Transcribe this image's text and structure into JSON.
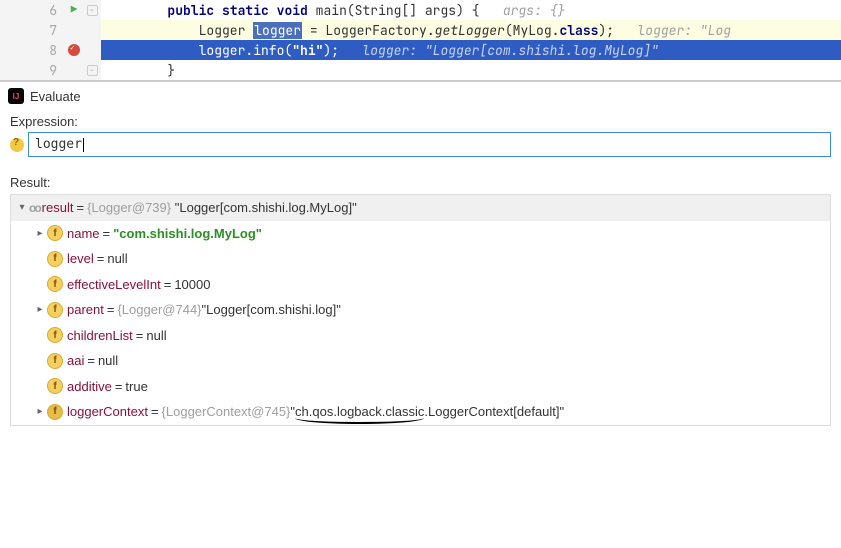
{
  "editor": {
    "lines": {
      "l6": {
        "no": "6",
        "indent": "        ",
        "k1": "public",
        "k2": "static",
        "k3": "void",
        "method": "main",
        "args": "(String[] args) {",
        "hint": "args: {}"
      },
      "l7": {
        "no": "7",
        "indent": "            ",
        "t1": "Logger ",
        "sel": "logger",
        "t2": " = LoggerFactory.",
        "call": "getLogger",
        "t3": "(MyLog.",
        "cls": "class",
        "t4": ");",
        "hint": "logger: \"Log"
      },
      "l8": {
        "no": "8",
        "indent": "            ",
        "t1": "logger.info(",
        "str": "\"hi\"",
        "t2": ");",
        "hint": "logger: \"Logger[com.shishi.log.MyLog]\""
      },
      "l9": {
        "no": "9",
        "indent": "        ",
        "brace": "}"
      }
    }
  },
  "evaluate": {
    "title": "Evaluate",
    "expr_label": "Expression:",
    "expr_value": "logger",
    "result_label": "Result:",
    "result_header": {
      "name": "result",
      "type": "{Logger@739}",
      "value": "\"Logger[com.shishi.log.MyLog]\""
    },
    "fields": [
      {
        "name": "name",
        "value_green": "\"com.shishi.log.MyLog\"",
        "expandable": true
      },
      {
        "name": "level",
        "value": "null",
        "expandable": false
      },
      {
        "name": "effectiveLevelInt",
        "value": "10000",
        "expandable": false
      },
      {
        "name": "parent",
        "type": "{Logger@744}",
        "value": "\"Logger[com.shishi.log]\"",
        "expandable": true
      },
      {
        "name": "childrenList",
        "value": "null",
        "expandable": false
      },
      {
        "name": "aai",
        "value": "null",
        "expandable": false
      },
      {
        "name": "additive",
        "value": "true",
        "expandable": false
      },
      {
        "name": "loggerContext",
        "type": "{LoggerContext@745}",
        "value": "\"ch.qos.logback.classic.LoggerContext[default]\"",
        "expandable": true,
        "dark": true,
        "underline_val": true
      }
    ]
  }
}
